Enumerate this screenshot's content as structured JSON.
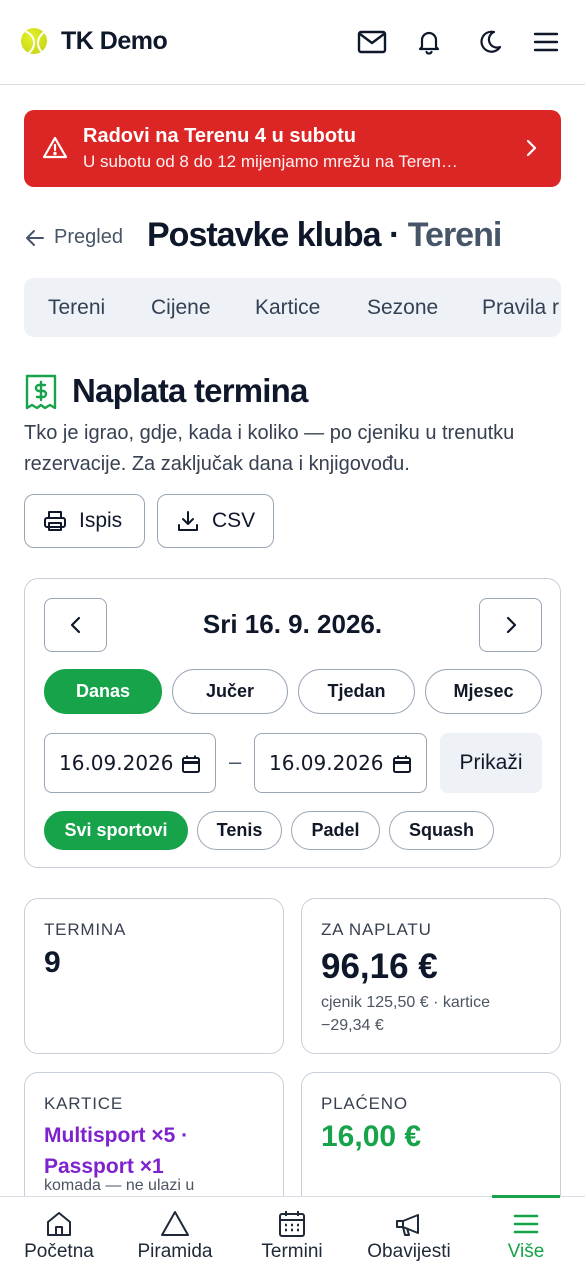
{
  "header": {
    "brand": "TK Demo",
    "icons": [
      "mail-icon",
      "bell-icon",
      "moon-icon",
      "menu-icon"
    ]
  },
  "alert": {
    "title": "Radovi na Terenu 4 u subotu",
    "text": "U subotu od 8 do 12 mijenjamo mrežu na Teren…",
    "color": "#dc2626"
  },
  "page": {
    "back_label": "Pregled",
    "title": "Postavke kluba",
    "separator": "·",
    "subtitle": "Tereni"
  },
  "tabs": [
    "Tereni",
    "Cijene",
    "Kartice",
    "Sezone",
    "Pravila r"
  ],
  "section": {
    "title": "Naplata termina",
    "description": "Tko je igrao, gdje, kada i koliko — po cjeniku u trenutku rezervacije. Za zaključak dana i knjigovođu.",
    "print_label": "Ispis",
    "csv_label": "CSV"
  },
  "filter": {
    "date_title": "Sri 16. 9. 2026.",
    "ranges": [
      "Danas",
      "Jučer",
      "Tjedan",
      "Mjesec"
    ],
    "active_range": "Danas",
    "date_from": "16.09.2026",
    "date_to": "16.09.2026",
    "dash": "–",
    "show_label": "Prikaži",
    "sports": [
      "Svi sportovi",
      "Tenis",
      "Padel",
      "Squash"
    ],
    "active_sport": "Svi sportovi",
    "accent": "#16a34a"
  },
  "stats": {
    "termina": {
      "label": "TERMINA",
      "value": "9"
    },
    "za_naplatu": {
      "label": "ZA NAPLATU",
      "value": "96,16 €",
      "note": "cjenik 125,50 € · kartice −29,34 €"
    },
    "kartice": {
      "label": "KARTICE",
      "value": "Multisport ×5 · Passport ×1",
      "note": "komada — ne ulazi u",
      "color": "#7e22ce"
    },
    "placeno": {
      "label": "PLAĆENO",
      "value": "16,00 €",
      "color": "#16a34a"
    }
  },
  "bottom_nav": {
    "items": [
      "Početna",
      "Piramida",
      "Termini",
      "Obavijesti",
      "Više"
    ],
    "active": "Više"
  }
}
